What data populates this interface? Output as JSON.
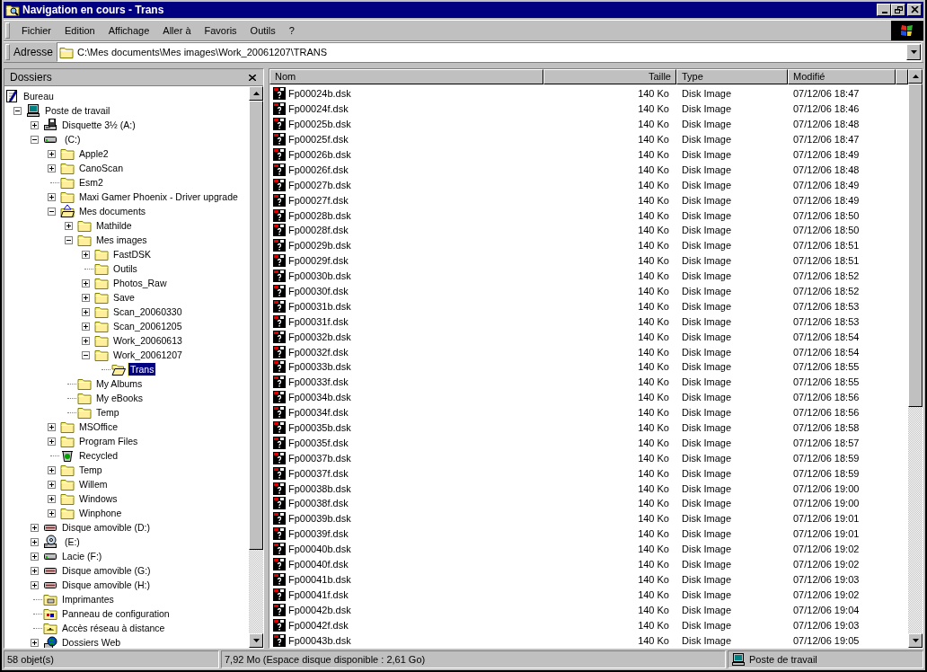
{
  "window": {
    "title": "Navigation en cours - Trans"
  },
  "menu": [
    "Fichier",
    "Edition",
    "Affichage",
    "Aller à",
    "Favoris",
    "Outils",
    "?"
  ],
  "address": {
    "label": "Adresse",
    "value": "C:\\Mes documents\\Mes images\\Work_20061207\\TRANS"
  },
  "folders_pane": {
    "title": "Dossiers"
  },
  "tree": [
    {
      "label": "Bureau",
      "kind": "desktop",
      "expandable": false,
      "expanded": false,
      "selected": false,
      "children": [
        {
          "label": "Poste de travail",
          "kind": "computer",
          "expandable": true,
          "expanded": true,
          "selected": false,
          "children": [
            {
              "label": "Disquette 3½ (A:)",
              "kind": "floppy",
              "expandable": true,
              "expanded": false,
              "selected": false
            },
            {
              "label": " (C:)",
              "kind": "drive",
              "expandable": true,
              "expanded": true,
              "selected": false,
              "children": [
                {
                  "label": "Apple2",
                  "kind": "folder",
                  "expandable": true,
                  "expanded": false,
                  "selected": false
                },
                {
                  "label": "CanoScan",
                  "kind": "folder",
                  "expandable": true,
                  "expanded": false,
                  "selected": false
                },
                {
                  "label": "Esm2",
                  "kind": "folder",
                  "expandable": false,
                  "expanded": false,
                  "selected": false
                },
                {
                  "label": "Maxi Gamer Phoenix - Driver upgrade",
                  "kind": "folder",
                  "expandable": true,
                  "expanded": false,
                  "selected": false
                },
                {
                  "label": "Mes documents",
                  "kind": "documents",
                  "expandable": true,
                  "expanded": true,
                  "selected": false,
                  "children": [
                    {
                      "label": "Mathilde",
                      "kind": "folder",
                      "expandable": true,
                      "expanded": false,
                      "selected": false
                    },
                    {
                      "label": "Mes images",
                      "kind": "folder",
                      "expandable": true,
                      "expanded": true,
                      "selected": false,
                      "children": [
                        {
                          "label": "FastDSK",
                          "kind": "folder",
                          "expandable": true,
                          "expanded": false,
                          "selected": false
                        },
                        {
                          "label": "Outils",
                          "kind": "folder",
                          "expandable": false,
                          "expanded": false,
                          "selected": false
                        },
                        {
                          "label": "Photos_Raw",
                          "kind": "folder",
                          "expandable": true,
                          "expanded": false,
                          "selected": false
                        },
                        {
                          "label": "Save",
                          "kind": "folder",
                          "expandable": true,
                          "expanded": false,
                          "selected": false
                        },
                        {
                          "label": "Scan_20060330",
                          "kind": "folder",
                          "expandable": true,
                          "expanded": false,
                          "selected": false
                        },
                        {
                          "label": "Scan_20061205",
                          "kind": "folder",
                          "expandable": true,
                          "expanded": false,
                          "selected": false
                        },
                        {
                          "label": "Work_20060613",
                          "kind": "folder",
                          "expandable": true,
                          "expanded": false,
                          "selected": false
                        },
                        {
                          "label": "Work_20061207",
                          "kind": "folder",
                          "expandable": true,
                          "expanded": true,
                          "selected": false,
                          "children": [
                            {
                              "label": "Trans",
                              "kind": "folder-open",
                              "expandable": false,
                              "expanded": false,
                              "selected": true
                            }
                          ]
                        }
                      ]
                    },
                    {
                      "label": "My Albums",
                      "kind": "folder",
                      "expandable": false,
                      "expanded": false,
                      "selected": false
                    },
                    {
                      "label": "My eBooks",
                      "kind": "folder",
                      "expandable": false,
                      "expanded": false,
                      "selected": false
                    },
                    {
                      "label": "Temp",
                      "kind": "folder",
                      "expandable": false,
                      "expanded": false,
                      "selected": false
                    }
                  ]
                },
                {
                  "label": "MSOffice",
                  "kind": "folder",
                  "expandable": true,
                  "expanded": false,
                  "selected": false
                },
                {
                  "label": "Program Files",
                  "kind": "folder",
                  "expandable": true,
                  "expanded": false,
                  "selected": false
                },
                {
                  "label": "Recycled",
                  "kind": "recycle",
                  "expandable": false,
                  "expanded": false,
                  "selected": false
                },
                {
                  "label": "Temp",
                  "kind": "folder",
                  "expandable": true,
                  "expanded": false,
                  "selected": false
                },
                {
                  "label": "Willem",
                  "kind": "folder",
                  "expandable": true,
                  "expanded": false,
                  "selected": false
                },
                {
                  "label": "Windows",
                  "kind": "folder",
                  "expandable": true,
                  "expanded": false,
                  "selected": false
                },
                {
                  "label": "Winphone",
                  "kind": "folder",
                  "expandable": true,
                  "expanded": false,
                  "selected": false
                }
              ]
            },
            {
              "label": "Disque amovible (D:)",
              "kind": "removable",
              "expandable": true,
              "expanded": false,
              "selected": false
            },
            {
              "label": " (E:)",
              "kind": "cdrom",
              "expandable": true,
              "expanded": false,
              "selected": false
            },
            {
              "label": "Lacie (F:)",
              "kind": "drive",
              "expandable": true,
              "expanded": false,
              "selected": false
            },
            {
              "label": "Disque amovible (G:)",
              "kind": "removable",
              "expandable": true,
              "expanded": false,
              "selected": false
            },
            {
              "label": "Disque amovible (H:)",
              "kind": "removable",
              "expandable": true,
              "expanded": false,
              "selected": false
            },
            {
              "label": "Imprimantes",
              "kind": "printers",
              "expandable": false,
              "expanded": false,
              "selected": false
            },
            {
              "label": "Panneau de configuration",
              "kind": "control",
              "expandable": false,
              "expanded": false,
              "selected": false
            },
            {
              "label": "Accès réseau à distance",
              "kind": "dialup",
              "expandable": false,
              "expanded": false,
              "selected": false
            },
            {
              "label": "Dossiers Web",
              "kind": "web",
              "expandable": true,
              "expanded": false,
              "selected": false
            }
          ]
        }
      ]
    }
  ],
  "columns": [
    "Nom",
    "Taille",
    "Type",
    "Modifié"
  ],
  "files": [
    [
      "Fp00024b.dsk",
      "140 Ko",
      "Disk Image",
      "07/12/06 18:47"
    ],
    [
      "Fp00024f.dsk",
      "140 Ko",
      "Disk Image",
      "07/12/06 18:46"
    ],
    [
      "Fp00025b.dsk",
      "140 Ko",
      "Disk Image",
      "07/12/06 18:48"
    ],
    [
      "Fp00025f.dsk",
      "140 Ko",
      "Disk Image",
      "07/12/06 18:47"
    ],
    [
      "Fp00026b.dsk",
      "140 Ko",
      "Disk Image",
      "07/12/06 18:49"
    ],
    [
      "Fp00026f.dsk",
      "140 Ko",
      "Disk Image",
      "07/12/06 18:48"
    ],
    [
      "Fp00027b.dsk",
      "140 Ko",
      "Disk Image",
      "07/12/06 18:49"
    ],
    [
      "Fp00027f.dsk",
      "140 Ko",
      "Disk Image",
      "07/12/06 18:49"
    ],
    [
      "Fp00028b.dsk",
      "140 Ko",
      "Disk Image",
      "07/12/06 18:50"
    ],
    [
      "Fp00028f.dsk",
      "140 Ko",
      "Disk Image",
      "07/12/06 18:50"
    ],
    [
      "Fp00029b.dsk",
      "140 Ko",
      "Disk Image",
      "07/12/06 18:51"
    ],
    [
      "Fp00029f.dsk",
      "140 Ko",
      "Disk Image",
      "07/12/06 18:51"
    ],
    [
      "Fp00030b.dsk",
      "140 Ko",
      "Disk Image",
      "07/12/06 18:52"
    ],
    [
      "Fp00030f.dsk",
      "140 Ko",
      "Disk Image",
      "07/12/06 18:52"
    ],
    [
      "Fp00031b.dsk",
      "140 Ko",
      "Disk Image",
      "07/12/06 18:53"
    ],
    [
      "Fp00031f.dsk",
      "140 Ko",
      "Disk Image",
      "07/12/06 18:53"
    ],
    [
      "Fp00032b.dsk",
      "140 Ko",
      "Disk Image",
      "07/12/06 18:54"
    ],
    [
      "Fp00032f.dsk",
      "140 Ko",
      "Disk Image",
      "07/12/06 18:54"
    ],
    [
      "Fp00033b.dsk",
      "140 Ko",
      "Disk Image",
      "07/12/06 18:55"
    ],
    [
      "Fp00033f.dsk",
      "140 Ko",
      "Disk Image",
      "07/12/06 18:55"
    ],
    [
      "Fp00034b.dsk",
      "140 Ko",
      "Disk Image",
      "07/12/06 18:56"
    ],
    [
      "Fp00034f.dsk",
      "140 Ko",
      "Disk Image",
      "07/12/06 18:56"
    ],
    [
      "Fp00035b.dsk",
      "140 Ko",
      "Disk Image",
      "07/12/06 18:58"
    ],
    [
      "Fp00035f.dsk",
      "140 Ko",
      "Disk Image",
      "07/12/06 18:57"
    ],
    [
      "Fp00037b.dsk",
      "140 Ko",
      "Disk Image",
      "07/12/06 18:59"
    ],
    [
      "Fp00037f.dsk",
      "140 Ko",
      "Disk Image",
      "07/12/06 18:59"
    ],
    [
      "Fp00038b.dsk",
      "140 Ko",
      "Disk Image",
      "07/12/06 19:00"
    ],
    [
      "Fp00038f.dsk",
      "140 Ko",
      "Disk Image",
      "07/12/06 19:00"
    ],
    [
      "Fp00039b.dsk",
      "140 Ko",
      "Disk Image",
      "07/12/06 19:01"
    ],
    [
      "Fp00039f.dsk",
      "140 Ko",
      "Disk Image",
      "07/12/06 19:01"
    ],
    [
      "Fp00040b.dsk",
      "140 Ko",
      "Disk Image",
      "07/12/06 19:02"
    ],
    [
      "Fp00040f.dsk",
      "140 Ko",
      "Disk Image",
      "07/12/06 19:02"
    ],
    [
      "Fp00041b.dsk",
      "140 Ko",
      "Disk Image",
      "07/12/06 19:03"
    ],
    [
      "Fp00041f.dsk",
      "140 Ko",
      "Disk Image",
      "07/12/06 19:02"
    ],
    [
      "Fp00042b.dsk",
      "140 Ko",
      "Disk Image",
      "07/12/06 19:04"
    ],
    [
      "Fp00042f.dsk",
      "140 Ko",
      "Disk Image",
      "07/12/06 19:03"
    ],
    [
      "Fp00043b.dsk",
      "140 Ko",
      "Disk Image",
      "07/12/06 19:05"
    ]
  ],
  "status_bar": [
    "58 objet(s)",
    "7,92 Mo (Espace disque disponible : 2,61 Go)",
    "Poste de travail"
  ]
}
